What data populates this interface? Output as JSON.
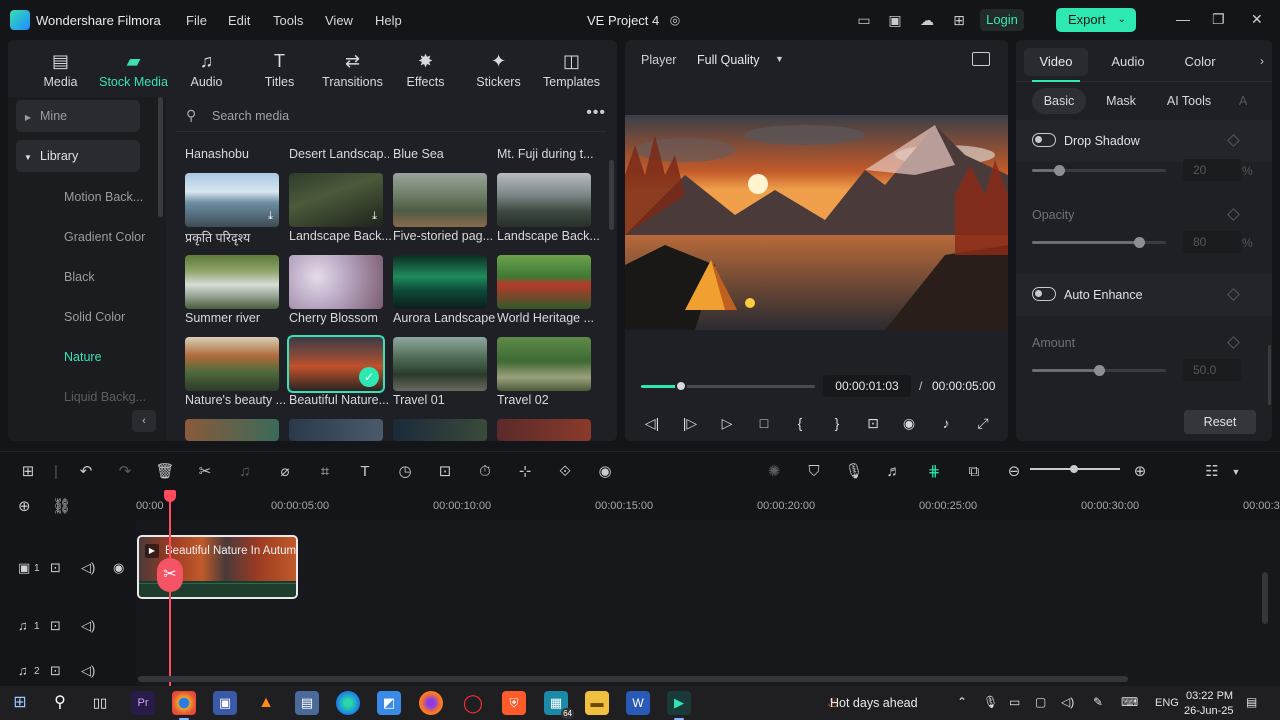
{
  "titlebar": {
    "app_name": "Wondershare Filmora",
    "menus": [
      "File",
      "Edit",
      "Tools",
      "View",
      "Help"
    ],
    "project_name": "VE Project 4",
    "login_label": "Login",
    "export_label": "Export"
  },
  "media": {
    "tabs": [
      {
        "label": "Media",
        "icon": "media-icon"
      },
      {
        "label": "Stock Media",
        "icon": "stock-media-icon"
      },
      {
        "label": "Audio",
        "icon": "audio-icon"
      },
      {
        "label": "Titles",
        "icon": "titles-icon"
      },
      {
        "label": "Transitions",
        "icon": "transitions-icon"
      },
      {
        "label": "Effects",
        "icon": "effects-icon"
      },
      {
        "label": "Stickers",
        "icon": "stickers-icon"
      },
      {
        "label": "Templates",
        "icon": "templates-icon"
      }
    ],
    "active_tab": "Stock Media",
    "sidebar": {
      "mine": "Mine",
      "library": "Library",
      "items": [
        "Motion Back...",
        "Gradient Color",
        "Black",
        "Solid Color",
        "Nature",
        "Liquid Backg..."
      ],
      "selected": "Nature"
    },
    "search_placeholder": "Search media",
    "column_headers": [
      "Hanashobu",
      "Desert Landscap...",
      "Blue Sea",
      "Mt. Fuji during t..."
    ],
    "grid": [
      [
        "प्रकृति परिदृश्य",
        "Landscape Back...",
        "Five-storied pag...",
        "Landscape Back..."
      ],
      [
        "Summer river",
        "Cherry Blossom",
        "Aurora Landscape",
        "World Heritage ..."
      ],
      [
        "Nature's beauty ...",
        "Beautiful Nature...",
        "Travel 01",
        "Travel 02"
      ]
    ],
    "selected_item": "Beautiful Nature..."
  },
  "player": {
    "label": "Player",
    "quality": "Full Quality",
    "progress": 0.23,
    "current_time": "00:00:01:03",
    "separator": "/",
    "total_time": "00:00:05:00"
  },
  "props": {
    "tabs": [
      "Video",
      "Audio",
      "Color"
    ],
    "active_tab": "Video",
    "subtabs": [
      "Basic",
      "Mask",
      "AI Tools",
      "A"
    ],
    "active_subtab": "Basic",
    "drop_shadow_label": "Drop Shadow",
    "drop_shadow_value": "20",
    "drop_shadow_unit": "%",
    "drop_shadow_level": 0.2,
    "opacity_label": "Opacity",
    "opacity_value": "80",
    "opacity_unit": "%",
    "opacity_level": 0.8,
    "auto_enhance_label": "Auto Enhance",
    "amount_label": "Amount",
    "amount_value": "50.0",
    "amount_level": 0.5,
    "reset_label": "Reset"
  },
  "timeline": {
    "ticks": [
      "00:00",
      "00:00:05:00",
      "00:00:10:00",
      "00:00:15:00",
      "00:00:20:00",
      "00:00:25:00",
      "00:00:30:00",
      "00:00:3"
    ],
    "clip_title": "Beautiful Nature In Autumn",
    "tracks": [
      {
        "icon": "video-track-icon",
        "num": "1"
      },
      {
        "icon": "audio-track-icon",
        "num": "1"
      },
      {
        "icon": "audio-track-icon",
        "num": "2"
      }
    ]
  },
  "taskbar": {
    "weather": "Hot days ahead",
    "badge": "64",
    "lang": "ENG",
    "time": "03:22 PM",
    "date": "26-Jun-25"
  }
}
